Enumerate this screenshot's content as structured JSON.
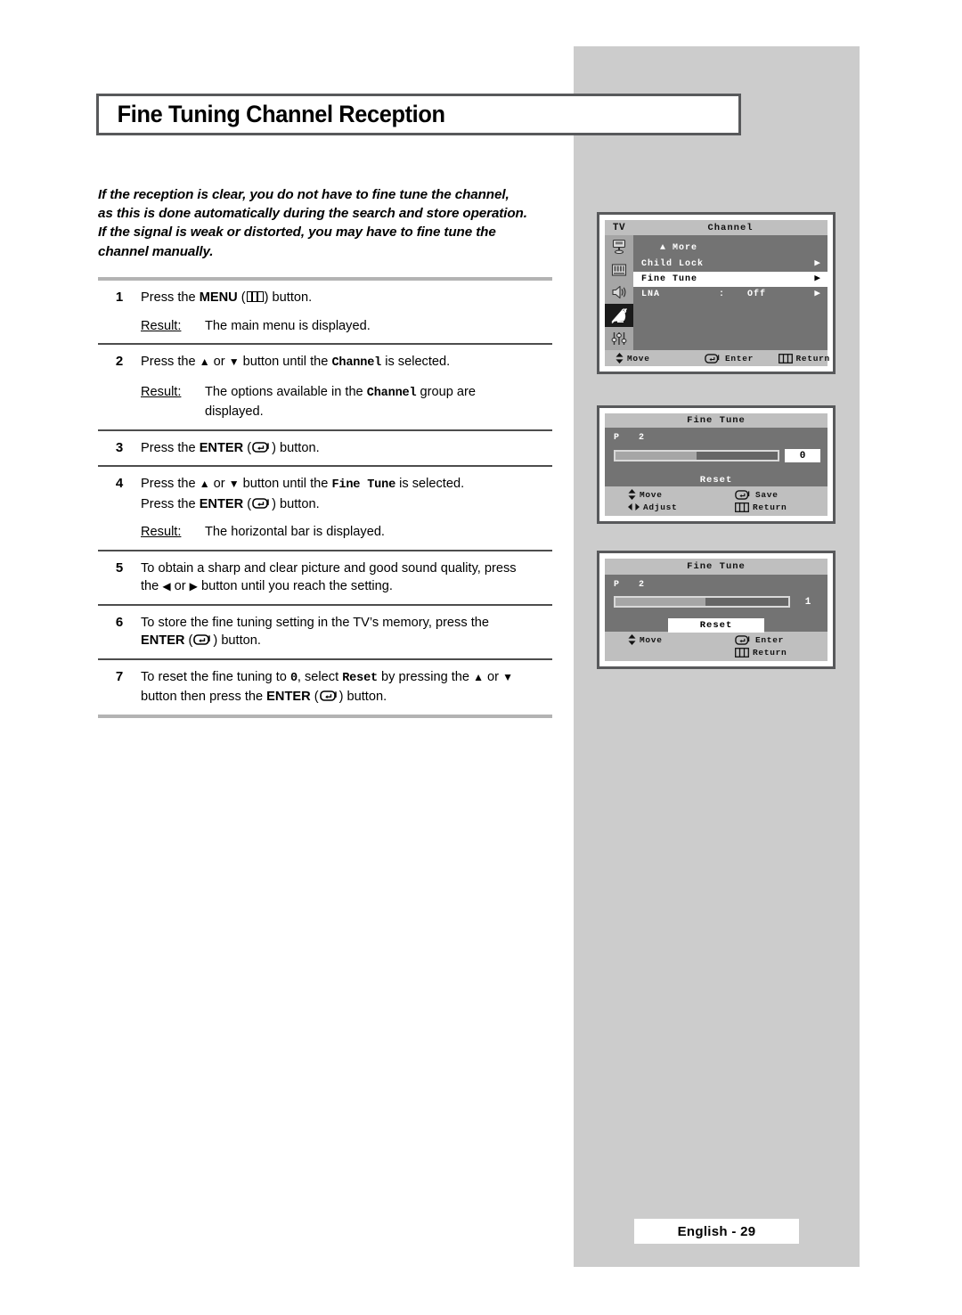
{
  "page": {
    "title": "Fine Tuning Channel Reception",
    "footer_label": "English - 29",
    "accent_gray": "#cccccc",
    "border_gray": "#58595b"
  },
  "intro": {
    "line1": "If the reception is clear, you do not have to fine tune the channel,",
    "line2": "as this is done automatically during the search and store operation.",
    "line3": "If the signal is weak or distorted, you may have to fine tune the",
    "line4": "channel manually."
  },
  "steps": [
    {
      "num": "1",
      "pre": "Press the ",
      "bold": "MENU",
      "icon": "menu-icon",
      "post": " button.",
      "result_label": "Result:",
      "result_text": "The main menu is displayed."
    },
    {
      "num": "2",
      "pre": "Press the ",
      "up": "▲",
      "or": " or ",
      "down": "▼",
      "mid": " button until the ",
      "mono": "Channel",
      "post": " is selected.",
      "result_label": "Result:",
      "result_text_1": "The options available in the ",
      "result_mono": "Channel",
      "result_text_2": " group are",
      "result_text_3": "displayed."
    },
    {
      "num": "3",
      "pre": "Press the ",
      "bold": "ENTER",
      "icon": "enter-icon",
      "post": " button."
    },
    {
      "num": "4",
      "pre": "Press the ",
      "up": "▲",
      "or": " or ",
      "down": "▼",
      "mid": " button until the ",
      "mono": "Fine Tune",
      "post": " is selected.",
      "line2_pre": "Press the ",
      "line2_bold": "ENTER",
      "line2_post": " button.",
      "result_label": "Result:",
      "result_text": "The horizontal bar is displayed."
    },
    {
      "num": "5",
      "l1": "To obtain a sharp and clear picture and good sound quality, press",
      "l2_pre": "the ",
      "l2_left": "◀",
      "l2_or": " or ",
      "l2_right": "▶",
      "l2_post": " button until you reach the setting."
    },
    {
      "num": "6",
      "l1": "To store the fine tuning setting in the TV’s memory, press the",
      "l2_bold": "ENTER",
      "l2_post": " button."
    },
    {
      "num": "7",
      "l1_pre": "To reset the fine tuning to ",
      "l1_zero": "0",
      "l1_mid": ", select ",
      "l1_mono": "Reset",
      "l1_mid2": " by pressing the ",
      "l1_up": "▲",
      "l1_or": " or ",
      "l1_down": "▼",
      "l2_pre": "button then press the ",
      "l2_bold": "ENTER",
      "l2_post": " button."
    }
  ],
  "osd_channel": {
    "tv_label": "TV",
    "title": "Channel",
    "more": "More",
    "more_caret": "▲",
    "rows": [
      {
        "label": "Child Lock",
        "colon": "",
        "value": "",
        "caret": "▶",
        "active": false
      },
      {
        "label": "Fine Tune",
        "colon": "",
        "value": "",
        "caret": "▶",
        "active": true
      },
      {
        "label": "LNA",
        "colon": ":",
        "value": "Off",
        "caret": "▶",
        "active": false
      }
    ],
    "footer": {
      "move": "Move",
      "enter": "Enter",
      "return": "Return"
    },
    "icons": [
      "picture-icon",
      "bars-icon",
      "speaker-icon",
      "satellite-dish-icon",
      "sliders-icon"
    ],
    "selected_icon_index": 3
  },
  "osd_fine_tune_1": {
    "title": "Fine Tune",
    "program_label": "P",
    "program_number": "2",
    "bar_percent": 50,
    "value": "0",
    "value_highlighted": true,
    "reset_label": "Reset",
    "reset_highlighted": false,
    "footer": {
      "move": "Move",
      "save": "Save",
      "adjust": "Adjust",
      "return": "Return"
    }
  },
  "osd_fine_tune_2": {
    "title": "Fine Tune",
    "program_label": "P",
    "program_number": "2",
    "bar_percent": 52,
    "value": "1",
    "value_highlighted": false,
    "reset_label": "Reset",
    "reset_highlighted": true,
    "footer": {
      "move": "Move",
      "enter": "Enter",
      "return": "Return"
    }
  }
}
